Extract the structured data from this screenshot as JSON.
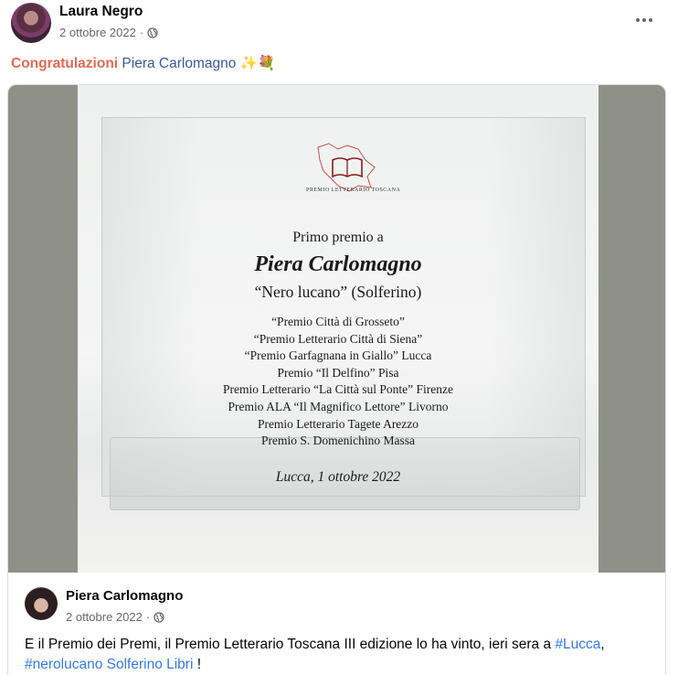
{
  "post": {
    "author": "Laura Negro",
    "date": "2 ottobre 2022",
    "privacy_icon": "globe-icon",
    "more_icon": "more-options-icon",
    "text": {
      "word": "Congratulazioni",
      "mention": "Piera Carlomagno",
      "emojis": "✨💐"
    }
  },
  "shared": {
    "photo": {
      "logo_text": "PREMIO LETTERARIO TOSCANA",
      "intro": "Primo premio a",
      "name": "Piera Carlomagno",
      "book": "“Nero lucano” (Solferino)",
      "awards": [
        "“Premio Città di Grosseto”",
        "“Premio Letterario Città di Siena”",
        "“Premio Garfagnana in Giallo” Lucca",
        "Premio “Il Delfino” Pisa",
        "Premio Letterario “La Città sul Ponte” Firenze",
        "Premio ALA “Il Magnifico Lettore” Livorno",
        "Premio Letterario Tagete Arezzo",
        "Premio S. Domenichino Massa"
      ],
      "date_line": "Lucca, 1 ottobre 2022"
    },
    "author": "Piera Carlomagno",
    "date": "2 ottobre 2022",
    "text_before": "E il Premio dei Premi, il Premio Letterario Toscana III edizione lo ha vinto, ieri sera a ",
    "hashtag1": "#Lucca",
    "text_mid": ", ",
    "hashtag2": "#nerolucano",
    "link": " Solferino Libri",
    "text_end": " !"
  }
}
